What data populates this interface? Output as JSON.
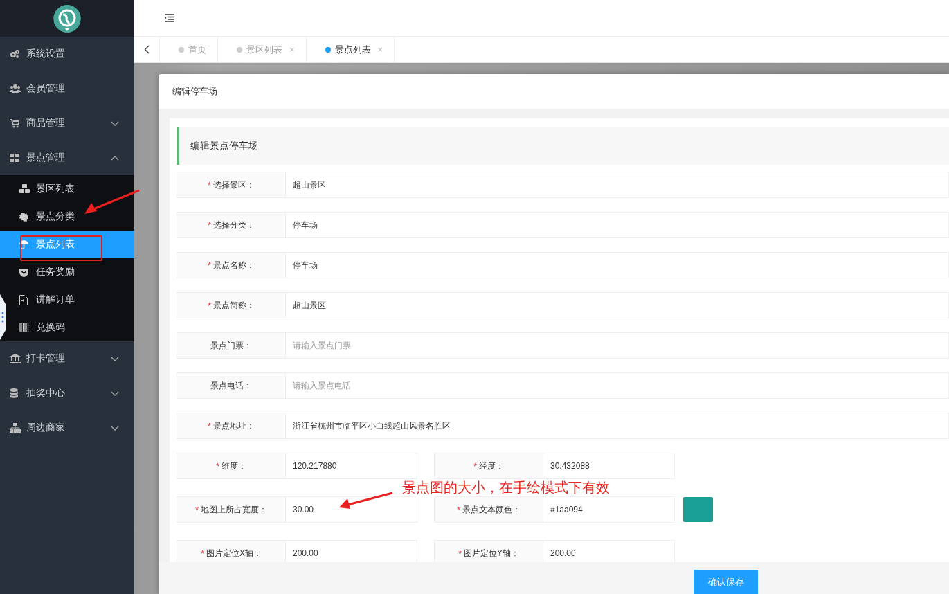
{
  "sidebar": {
    "items": [
      {
        "label": "系统设置",
        "selected": false
      },
      {
        "label": "会员管理",
        "selected": false
      },
      {
        "label": "商品管理",
        "selected": false,
        "expanded": false
      },
      {
        "label": "景点管理",
        "selected": false,
        "expanded": true,
        "children": [
          {
            "label": "景区列表",
            "selected": false
          },
          {
            "label": "景点分类",
            "selected": false
          },
          {
            "label": "景点列表",
            "selected": true
          },
          {
            "label": "任务奖励",
            "selected": false
          },
          {
            "label": "讲解订单",
            "selected": false
          },
          {
            "label": "兑换码",
            "selected": false
          }
        ]
      },
      {
        "label": "打卡管理",
        "selected": false,
        "expanded": false
      },
      {
        "label": "抽奖中心",
        "selected": false,
        "expanded": false
      },
      {
        "label": "周边商家",
        "selected": false,
        "expanded": false
      }
    ]
  },
  "tabs": [
    {
      "label": "首页",
      "selected": false
    },
    {
      "label": "景区列表",
      "selected": false,
      "close": "×"
    },
    {
      "label": "景点列表",
      "selected": true,
      "close": "×"
    }
  ],
  "dialog": {
    "title": "编辑停车场",
    "section_title": "编辑景点停车场",
    "rows": [
      {
        "kind": "full",
        "fields": [
          {
            "label": "选择景区：",
            "required_mark": "*",
            "value": "超山景区"
          }
        ]
      },
      {
        "kind": "full",
        "fields": [
          {
            "label": "选择分类：",
            "required_mark": "*",
            "value": "停车场"
          }
        ]
      },
      {
        "kind": "full",
        "fields": [
          {
            "label": "景点名称：",
            "required_mark": "*",
            "value": "停车场"
          }
        ]
      },
      {
        "kind": "full",
        "fields": [
          {
            "label": "景点简称：",
            "required_mark": "*",
            "value": "超山景区"
          }
        ]
      },
      {
        "kind": "full",
        "fields": [
          {
            "label": "景点门票：",
            "placeholder": "请输入景点门票"
          }
        ]
      },
      {
        "kind": "full",
        "fields": [
          {
            "label": "景点电话：",
            "placeholder": "请输入景点电话"
          }
        ]
      },
      {
        "kind": "full",
        "fields": [
          {
            "label": "景点地址：",
            "required_mark": "*",
            "value": "浙江省杭州市临平区小白线超山风景名胜区"
          }
        ]
      },
      {
        "kind": "half",
        "fields": [
          {
            "label": "维度：",
            "required_mark": "*",
            "value": "120.217880"
          },
          {
            "label": "经度：",
            "required_mark": "*",
            "value": "30.432088"
          }
        ]
      },
      {
        "kind": "half",
        "fields": [
          {
            "label": "地图上所占宽度：",
            "required_mark": "*",
            "value": "30.00"
          },
          {
            "label": "景点文本颜色：",
            "required_mark": "*",
            "value": "#1aa094",
            "color": "#1aa094"
          }
        ]
      },
      {
        "kind": "half",
        "fields": [
          {
            "label": "图片定位X轴：",
            "required_mark": "*",
            "value": "200.00"
          },
          {
            "label": "图片定位Y轴：",
            "required_mark": "*",
            "value": "200.00"
          }
        ]
      }
    ],
    "save_button": "确认保存"
  },
  "annotation": {
    "note": "景点图的大小，在手绘模式下有效"
  }
}
